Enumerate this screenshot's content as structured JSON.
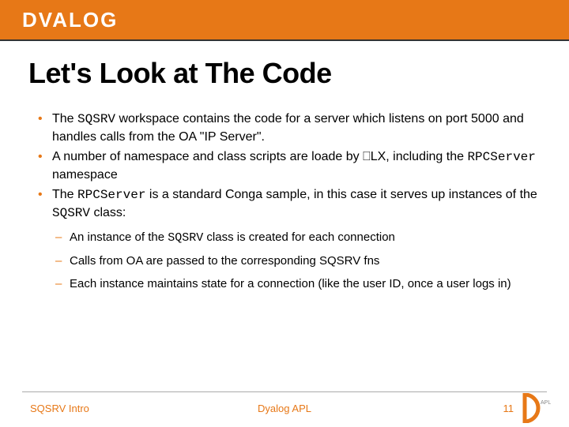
{
  "header": {
    "brand": "DVALOG"
  },
  "title": "Let's Look at The Code",
  "bullets": [
    {
      "pre": "The ",
      "code1": "SQSRV",
      "mid": " workspace contains the code for a server which listens on port 5000 and handles calls from the OA \"IP Server\".",
      "code2": "",
      "post": ""
    },
    {
      "pre": "A number of namespace and class scripts are loade by ⎕LX, including the ",
      "code1": "RPCServer",
      "mid": " namespace",
      "code2": "",
      "post": ""
    },
    {
      "pre": "The ",
      "code1": "RPCServer",
      "mid": " is a standard Conga sample, in this case it serves up instances of the ",
      "code2": "SQSRV",
      "post": " class:"
    }
  ],
  "subbullets": [
    {
      "pre": "An instance of the ",
      "code": "SQSRV",
      "post": " class is created for each connection"
    },
    {
      "pre": "Calls from OA are passed to the corresponding SQSRV fns",
      "code": "",
      "post": ""
    },
    {
      "pre": "Each instance maintains state for a connection (like the user ID, once a user logs in)",
      "code": "",
      "post": ""
    }
  ],
  "footer": {
    "left": "SQSRV Intro",
    "center": "Dyalog APL",
    "page": "11"
  }
}
